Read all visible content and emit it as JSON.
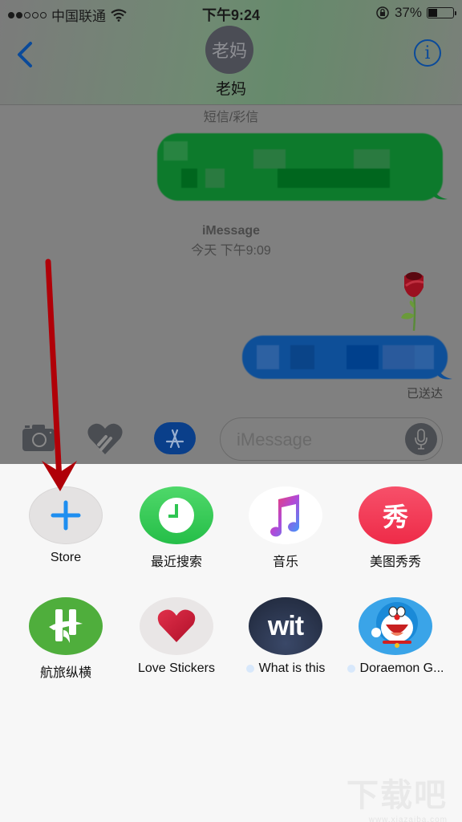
{
  "status_bar": {
    "signal_bars_filled": 2,
    "signal_bars_total": 5,
    "carrier": "中国联通",
    "wifi_icon": "wifi-icon",
    "time": "下午9:24",
    "rotation_lock_icon": "rotation-lock-icon",
    "battery_percent": "37%",
    "battery_level": 0.37
  },
  "header": {
    "back_icon": "chevron-left-icon",
    "avatar_initials": "老妈",
    "contact_name": "老妈",
    "info_icon": "info-icon",
    "info_glyph": "i"
  },
  "conversation": {
    "sms_label": "短信/彩信",
    "imessage_label": "iMessage",
    "imessage_timestamp": "今天 下午9:09",
    "sent_green_bubble": {
      "text": "[blurred]",
      "color": "#0d7a2c"
    },
    "sticker": "rose-sticker",
    "sent_blue_bubble": {
      "text": "[blurred]",
      "color": "#0e4f98"
    },
    "delivery_status": "已送达"
  },
  "composer": {
    "camera_icon": "camera-icon",
    "digital_touch_icon": "digital-touch-heart-icon",
    "appstore_icon": "app-store-icon",
    "input_placeholder": "iMessage",
    "mic_icon": "microphone-icon"
  },
  "app_drawer": {
    "apps": [
      {
        "label": "Store",
        "icon": "plus-icon",
        "color": "#e4e2e2",
        "has_dot": false
      },
      {
        "label": "最近搜索",
        "icon": "clock-icon",
        "color": "#2fc552",
        "has_dot": false
      },
      {
        "label": "音乐",
        "icon": "music-note-icon",
        "color": "#ffffff",
        "has_dot": false
      },
      {
        "label": "美图秀秀",
        "icon": "xiu-icon",
        "glyph": "秀",
        "color": "#f23a55",
        "has_dot": false
      },
      {
        "label": "航旅纵横",
        "icon": "hanglv-logo-icon",
        "color": "#4fae3c",
        "has_dot": false
      },
      {
        "label": "Love Stickers",
        "icon": "heart-icon",
        "color": "#e9e6e6",
        "has_dot": false
      },
      {
        "label": "What is this",
        "icon": "wit-logo-icon",
        "glyph": "wit",
        "color": "#2a3348",
        "has_dot": true
      },
      {
        "label": "Doraemon G...",
        "icon": "doraemon-icon",
        "color": "#3aa4e8",
        "has_dot": true
      }
    ]
  },
  "annotation": {
    "arrow": "red-arrow-pointing-to-store"
  },
  "watermark": {
    "text": "下载吧",
    "url": "www.xiazaiba.com"
  }
}
